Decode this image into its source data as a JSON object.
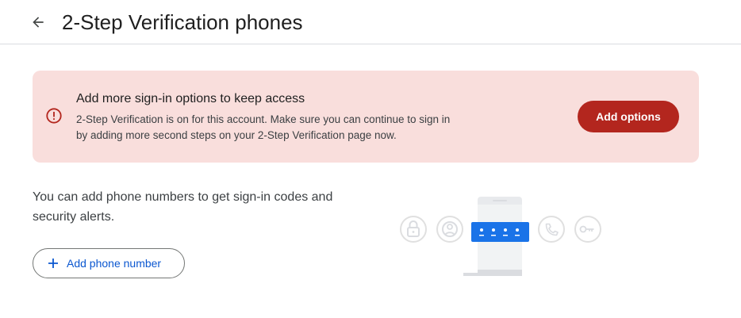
{
  "header": {
    "title": "2-Step Verification phones",
    "back_icon": "arrow-back-icon"
  },
  "alert": {
    "title": "Add more sign-in options to keep access",
    "body": "2-Step Verification is on for this account. Make sure you can continue to sign in by adding more second steps on your 2-Step Verification page now.",
    "button_label": "Add options",
    "icon": "error-icon",
    "background_color": "#f9dedc",
    "accent_color": "#b3261e"
  },
  "main": {
    "description": "You can add phone numbers to get sign-in codes and security alerts.",
    "add_phone_label": "Add phone number",
    "add_phone_icon": "plus-icon",
    "link_color": "#0b57d0"
  },
  "illustration": {
    "icons": [
      "lock-icon",
      "account-icon",
      "phone-with-code-icon",
      "phone-call-icon",
      "key-icon"
    ],
    "code_color": "#1a73e8"
  }
}
